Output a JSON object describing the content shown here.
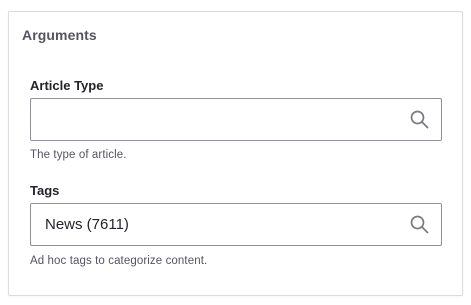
{
  "section": {
    "legend": "Arguments"
  },
  "article_type": {
    "label": "Article Type",
    "value": "",
    "description": "The type of article."
  },
  "tags": {
    "label": "Tags",
    "value": "News (7611)",
    "description": "Ad hoc tags to categorize content."
  },
  "icons": {
    "field_icon": "search-icon"
  },
  "colors": {
    "border": "#919297",
    "label": "#232429",
    "muted": "#545560"
  }
}
